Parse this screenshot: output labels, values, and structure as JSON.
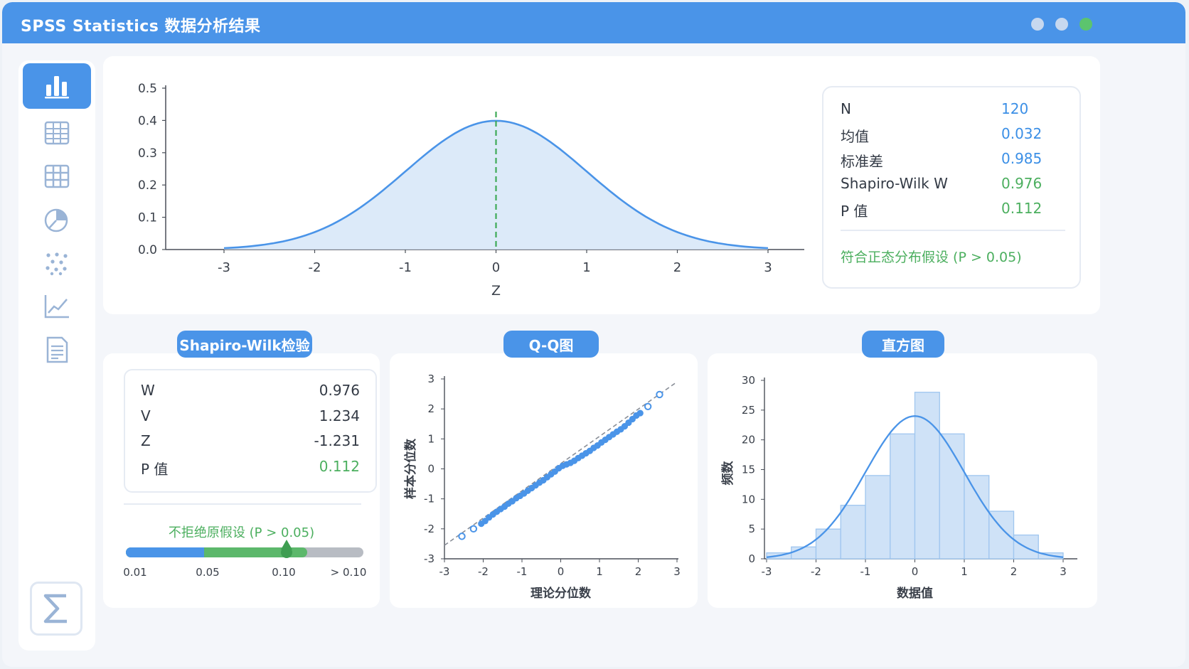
{
  "window": {
    "title": "SPSS Statistics 数据分析结果",
    "controls": [
      "minimize",
      "maximize",
      "close"
    ],
    "control_colors": [
      "#c7d8ef",
      "#c7d8ef",
      "#5cc46e"
    ]
  },
  "sidebar": {
    "items": [
      {
        "icon": "bar-chart-icon",
        "active": true
      },
      {
        "icon": "table-icon",
        "active": false
      },
      {
        "icon": "grid-icon",
        "active": false
      },
      {
        "icon": "pie-chart-icon",
        "active": false
      },
      {
        "icon": "scatter-icon",
        "active": false
      },
      {
        "icon": "line-chart-icon",
        "active": false
      },
      {
        "icon": "document-icon",
        "active": false
      }
    ],
    "bottom_icon": "sigma-icon"
  },
  "main_chart": {
    "xlabel": "Z",
    "xticks": [
      "-3",
      "-2",
      "-1",
      "0",
      "1",
      "2",
      "3"
    ],
    "yticks": [
      "0.0",
      "0.1",
      "0.2",
      "0.3",
      "0.4",
      "0.5"
    ]
  },
  "stats": {
    "rows": [
      {
        "label": "N",
        "value": "120",
        "color": "#3b8fe6"
      },
      {
        "label": "均值",
        "value": "0.032",
        "color": "#3b8fe6"
      },
      {
        "label": "标准差",
        "value": "0.985",
        "color": "#3b8fe6"
      },
      {
        "label": "Shapiro-Wilk W",
        "value": "0.976",
        "color": "#4caf5f"
      },
      {
        "label": "P 值",
        "value": "0.112",
        "color": "#4caf5f"
      }
    ],
    "conclusion": "符合正态分布假设 (P > 0.05)"
  },
  "sw_panel": {
    "title": "Shapiro-Wilk检验",
    "rows": [
      {
        "label": "W",
        "value": "0.976"
      },
      {
        "label": "V",
        "value": "1.234"
      },
      {
        "label": "Z",
        "value": "-1.231"
      },
      {
        "label": "P 值",
        "value": "0.112"
      }
    ],
    "decision": "不拒绝原假设 (P > 0.05)",
    "scale_labels": [
      "0.01",
      "0.05",
      "0.10",
      "> 0.10"
    ],
    "p_value": 0.112
  },
  "qq_panel": {
    "title": "Q-Q图",
    "xlabel": "理论分位数",
    "ylabel": "样本分位数"
  },
  "hist_panel": {
    "title": "直方图",
    "xlabel": "数据值",
    "ylabel": "频数"
  },
  "colors": {
    "accent": "#4a94e8",
    "green": "#4caf5f",
    "fill": "#d6e6f8"
  },
  "chart_data": [
    {
      "type": "area",
      "description_role": "normal density curve",
      "x": [
        -3,
        -2.5,
        -2,
        -1.5,
        -1,
        -0.5,
        0,
        0.5,
        1,
        1.5,
        2,
        2.5,
        3
      ],
      "y": [
        0.004,
        0.018,
        0.054,
        0.13,
        0.242,
        0.352,
        0.399,
        0.352,
        0.242,
        0.13,
        0.054,
        0.018,
        0.004
      ],
      "xlabel": "Z",
      "ylabel": "",
      "xlim": [
        -3,
        3
      ],
      "ylim": [
        0,
        0.5
      ],
      "reference_line_x": 0
    },
    {
      "type": "scatter",
      "title": "Q-Q图",
      "xlabel": "理论分位数",
      "ylabel": "样本分位数",
      "xlim": [
        -3,
        3
      ],
      "ylim": [
        -3,
        3
      ],
      "xticks": [
        -3,
        -2,
        -1,
        0,
        1,
        2,
        3
      ],
      "yticks": [
        -3,
        -2,
        -1,
        0,
        1,
        2,
        3
      ],
      "points": [
        [
          -2.55,
          -2.25
        ],
        [
          -2.25,
          -2.0
        ],
        [
          -2.05,
          -1.83
        ],
        [
          -1.95,
          -1.74
        ],
        [
          -1.85,
          -1.62
        ],
        [
          -1.75,
          -1.52
        ],
        [
          -1.65,
          -1.43
        ],
        [
          -1.55,
          -1.34
        ],
        [
          -1.45,
          -1.26
        ],
        [
          -1.35,
          -1.16
        ],
        [
          -1.25,
          -1.08
        ],
        [
          -1.15,
          -0.98
        ],
        [
          -1.05,
          -0.9
        ],
        [
          -0.95,
          -0.82
        ],
        [
          -0.85,
          -0.73
        ],
        [
          -0.75,
          -0.64
        ],
        [
          -0.65,
          -0.55
        ],
        [
          -0.55,
          -0.46
        ],
        [
          -0.45,
          -0.38
        ],
        [
          -0.35,
          -0.28
        ],
        [
          -0.25,
          -0.18
        ],
        [
          -0.15,
          -0.09
        ],
        [
          -0.05,
          0.02
        ],
        [
          0.05,
          0.1
        ],
        [
          0.15,
          0.15
        ],
        [
          0.25,
          0.2
        ],
        [
          0.35,
          0.27
        ],
        [
          0.45,
          0.36
        ],
        [
          0.55,
          0.44
        ],
        [
          0.65,
          0.52
        ],
        [
          0.75,
          0.6
        ],
        [
          0.85,
          0.7
        ],
        [
          0.95,
          0.78
        ],
        [
          1.05,
          0.88
        ],
        [
          1.15,
          0.97
        ],
        [
          1.25,
          1.06
        ],
        [
          1.35,
          1.15
        ],
        [
          1.45,
          1.24
        ],
        [
          1.55,
          1.32
        ],
        [
          1.65,
          1.42
        ],
        [
          1.75,
          1.54
        ],
        [
          1.85,
          1.66
        ],
        [
          1.95,
          1.78
        ],
        [
          2.05,
          1.86
        ],
        [
          2.25,
          2.08
        ],
        [
          2.55,
          2.48
        ]
      ],
      "open_points": [
        [
          -2.55,
          -2.25
        ],
        [
          -2.25,
          -2.0
        ],
        [
          2.25,
          2.08
        ],
        [
          2.55,
          2.48
        ]
      ],
      "reference_line": [
        [
          -3,
          -2.55
        ],
        [
          3,
          2.9
        ]
      ]
    },
    {
      "type": "bar",
      "title": "直方图",
      "xlabel": "数据值",
      "ylabel": "频数",
      "bin_edges": [
        -3,
        -2.5,
        -2,
        -1.5,
        -1,
        -0.5,
        0,
        0.5,
        1,
        1.5,
        2,
        2.5,
        3
      ],
      "values": [
        1,
        2,
        5,
        9,
        14,
        21,
        28,
        21,
        14,
        8,
        4,
        1
      ],
      "xlim": [
        -3,
        3
      ],
      "ylim": [
        0,
        30
      ],
      "yticks": [
        0,
        5,
        10,
        15,
        20,
        25,
        30
      ],
      "overlay_curve_peak": 24
    }
  ]
}
